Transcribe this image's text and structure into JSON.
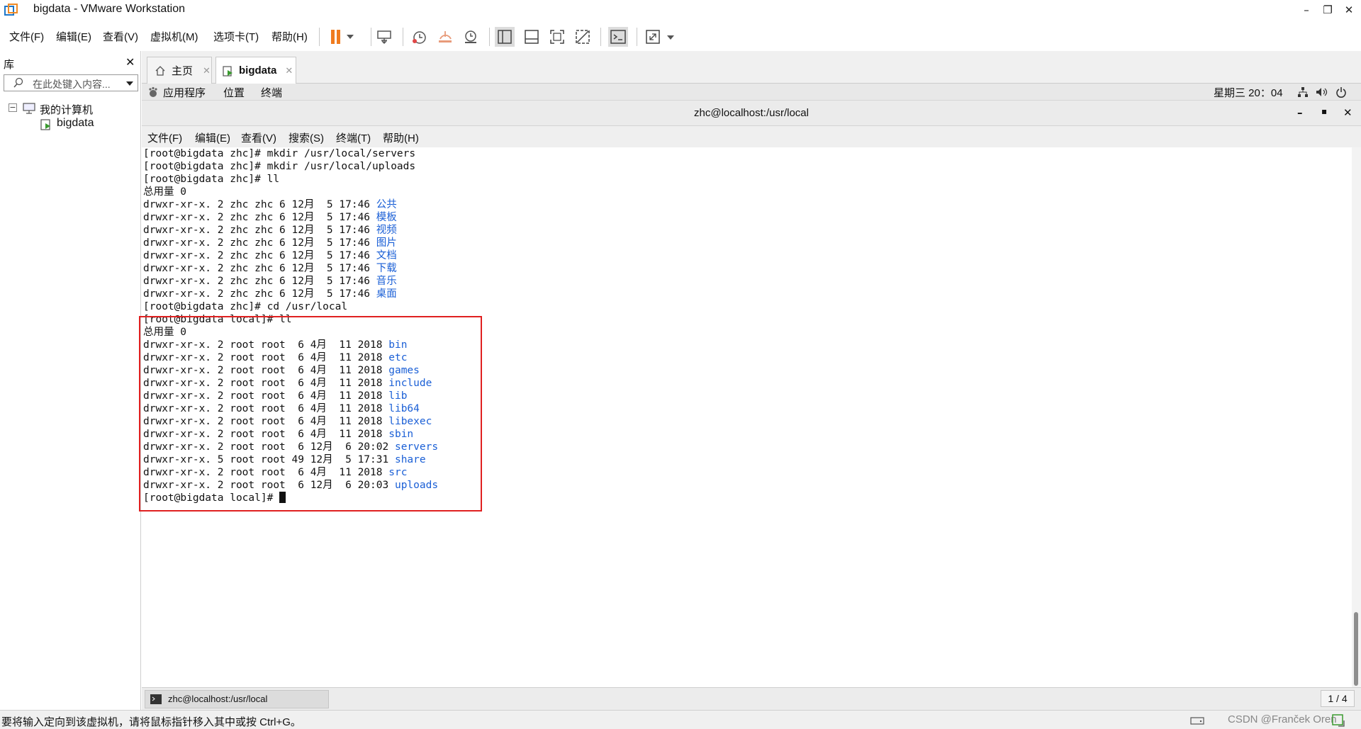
{
  "window": {
    "title": "bigdata - VMware Workstation"
  },
  "menubar": {
    "items": [
      "文件(F)",
      "编辑(E)",
      "查看(V)",
      "虚拟机(M)",
      "选项卡(T)",
      "帮助(H)"
    ]
  },
  "library": {
    "header": "库",
    "search_placeholder": "在此处键入内容...",
    "tree": {
      "root": "我的计算机",
      "child": "bigdata"
    }
  },
  "tabs": [
    {
      "label": "主页"
    },
    {
      "label": "bigdata"
    }
  ],
  "gnome": {
    "apps": "应用程序",
    "places": "位置",
    "terminal": "终端",
    "clock": "星期三 20：04"
  },
  "terminal": {
    "title": "zhc@localhost:/usr/local",
    "menu": [
      "文件(F)",
      "编辑(E)",
      "查看(V)",
      "搜索(S)",
      "终端(T)",
      "帮助(H)"
    ],
    "lines": [
      {
        "text": "[root@bigdata zhc]# mkdir /usr/local/servers",
        "name": ""
      },
      {
        "text": "[root@bigdata zhc]# mkdir /usr/local/uploads",
        "name": ""
      },
      {
        "text": "[root@bigdata zhc]# ll",
        "name": ""
      },
      {
        "text": "总用量 0",
        "name": ""
      },
      {
        "text": "drwxr-xr-x. 2 zhc zhc 6 12月  5 17:46 ",
        "name": "公共"
      },
      {
        "text": "drwxr-xr-x. 2 zhc zhc 6 12月  5 17:46 ",
        "name": "模板"
      },
      {
        "text": "drwxr-xr-x. 2 zhc zhc 6 12月  5 17:46 ",
        "name": "视频"
      },
      {
        "text": "drwxr-xr-x. 2 zhc zhc 6 12月  5 17:46 ",
        "name": "图片"
      },
      {
        "text": "drwxr-xr-x. 2 zhc zhc 6 12月  5 17:46 ",
        "name": "文档"
      },
      {
        "text": "drwxr-xr-x. 2 zhc zhc 6 12月  5 17:46 ",
        "name": "下载"
      },
      {
        "text": "drwxr-xr-x. 2 zhc zhc 6 12月  5 17:46 ",
        "name": "音乐"
      },
      {
        "text": "drwxr-xr-x. 2 zhc zhc 6 12月  5 17:46 ",
        "name": "桌面"
      },
      {
        "text": "[root@bigdata zhc]# cd /usr/local",
        "name": ""
      },
      {
        "text": "[root@bigdata local]# ll",
        "name": ""
      },
      {
        "text": "总用量 0",
        "name": ""
      },
      {
        "text": "drwxr-xr-x. 2 root root  6 4月  11 2018 ",
        "name": "bin"
      },
      {
        "text": "drwxr-xr-x. 2 root root  6 4月  11 2018 ",
        "name": "etc"
      },
      {
        "text": "drwxr-xr-x. 2 root root  6 4月  11 2018 ",
        "name": "games"
      },
      {
        "text": "drwxr-xr-x. 2 root root  6 4月  11 2018 ",
        "name": "include"
      },
      {
        "text": "drwxr-xr-x. 2 root root  6 4月  11 2018 ",
        "name": "lib"
      },
      {
        "text": "drwxr-xr-x. 2 root root  6 4月  11 2018 ",
        "name": "lib64"
      },
      {
        "text": "drwxr-xr-x. 2 root root  6 4月  11 2018 ",
        "name": "libexec"
      },
      {
        "text": "drwxr-xr-x. 2 root root  6 4月  11 2018 ",
        "name": "sbin"
      },
      {
        "text": "drwxr-xr-x. 2 root root  6 12月  6 20:02 ",
        "name": "servers"
      },
      {
        "text": "drwxr-xr-x. 5 root root 49 12月  5 17:31 ",
        "name": "share"
      },
      {
        "text": "drwxr-xr-x. 2 root root  6 4月  11 2018 ",
        "name": "src"
      },
      {
        "text": "drwxr-xr-x. 2 root root  6 12月  6 20:03 ",
        "name": "uploads"
      },
      {
        "text": "[root@bigdata local]# ",
        "name": ""
      }
    ]
  },
  "taskbar": {
    "item": "zhc@localhost:/usr/local",
    "pager": "1 / 4"
  },
  "statusbar": {
    "text": "要将输入定向到该虚拟机，请将鼠标指针移入其中或按 Ctrl+G。",
    "watermark": "CSDN @Franček Oren"
  },
  "colors": {
    "dirname": "#1a5fd6",
    "highlight_box": "#e02020",
    "pause_icon": "#f07b1f"
  }
}
